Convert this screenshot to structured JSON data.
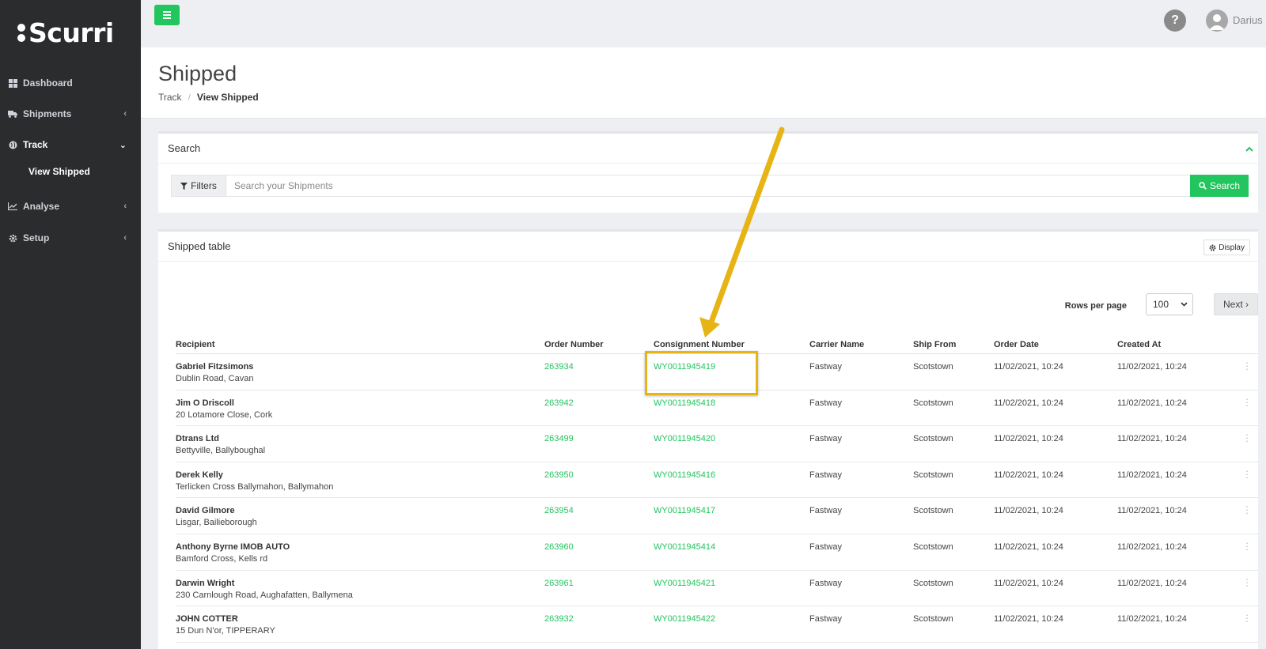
{
  "sidebar": {
    "logo_text": "Scurri",
    "items": [
      {
        "label": "Dashboard",
        "icon": "dashboard-icon"
      },
      {
        "label": "Shipments",
        "icon": "truck-icon"
      },
      {
        "label": "Track",
        "icon": "globe-icon"
      },
      {
        "label": "Analyse",
        "icon": "chart-icon"
      },
      {
        "label": "Setup",
        "icon": "gear-icon"
      }
    ],
    "sub_item": "View Shipped"
  },
  "topbar": {
    "help_label": "?",
    "user_name": "Darius"
  },
  "page": {
    "title": "Shipped",
    "breadcrumb": [
      "Track",
      "/",
      "View Shipped"
    ]
  },
  "search_panel": {
    "title": "Search",
    "filters_label": "Filters",
    "placeholder": "Search your Shipments",
    "search_label": "Search"
  },
  "table_panel": {
    "title": "Shipped table",
    "display_label": "Display",
    "rows_per_page_label": "Rows per page",
    "rows_per_page_value": "100",
    "next_label": "Next ›"
  },
  "table": {
    "headers": [
      "Recipient",
      "Order Number",
      "Consignment Number",
      "Carrier Name",
      "Ship From",
      "Order Date",
      "Created At"
    ],
    "rows": [
      {
        "name": "Gabriel Fitzsimons",
        "address": "Dublin Road, Cavan",
        "order": "263934",
        "consignment": "WY0011945419",
        "carrier": "Fastway",
        "ship_from": "Scotstown",
        "order_date": "11/02/2021, 10:24",
        "created_at": "11/02/2021, 10:24"
      },
      {
        "name": "Jim O Driscoll",
        "address": "20 Lotamore Close, Cork",
        "order": "263942",
        "consignment": "WY0011945418",
        "carrier": "Fastway",
        "ship_from": "Scotstown",
        "order_date": "11/02/2021, 10:24",
        "created_at": "11/02/2021, 10:24"
      },
      {
        "name": "Dtrans Ltd",
        "address": "Bettyville, Ballyboughal",
        "order": "263499",
        "consignment": "WY0011945420",
        "carrier": "Fastway",
        "ship_from": "Scotstown",
        "order_date": "11/02/2021, 10:24",
        "created_at": "11/02/2021, 10:24"
      },
      {
        "name": "Derek Kelly",
        "address": "Terlicken Cross Ballymahon, Ballymahon",
        "order": "263950",
        "consignment": "WY0011945416",
        "carrier": "Fastway",
        "ship_from": "Scotstown",
        "order_date": "11/02/2021, 10:24",
        "created_at": "11/02/2021, 10:24"
      },
      {
        "name": "David Gilmore",
        "address": "Lisgar, Bailieborough",
        "order": "263954",
        "consignment": "WY0011945417",
        "carrier": "Fastway",
        "ship_from": "Scotstown",
        "order_date": "11/02/2021, 10:24",
        "created_at": "11/02/2021, 10:24"
      },
      {
        "name": "Anthony Byrne IMOB AUTO",
        "address": "Bamford Cross, Kells rd",
        "order": "263960",
        "consignment": "WY0011945414",
        "carrier": "Fastway",
        "ship_from": "Scotstown",
        "order_date": "11/02/2021, 10:24",
        "created_at": "11/02/2021, 10:24"
      },
      {
        "name": "Darwin Wright",
        "address": "230 Carnlough Road, Aughafatten, Ballymena",
        "order": "263961",
        "consignment": "WY0011945421",
        "carrier": "Fastway",
        "ship_from": "Scotstown",
        "order_date": "11/02/2021, 10:24",
        "created_at": "11/02/2021, 10:24"
      },
      {
        "name": "JOHN COTTER",
        "address": "15 Dun N'or, TIPPERARY",
        "order": "263932",
        "consignment": "WY0011945422",
        "carrier": "Fastway",
        "ship_from": "Scotstown",
        "order_date": "11/02/2021, 10:24",
        "created_at": "11/02/2021, 10:24"
      }
    ]
  },
  "colors": {
    "accent": "#22c55e",
    "sidebar_bg": "#2b2c2e",
    "annotation": "#e7b416"
  }
}
